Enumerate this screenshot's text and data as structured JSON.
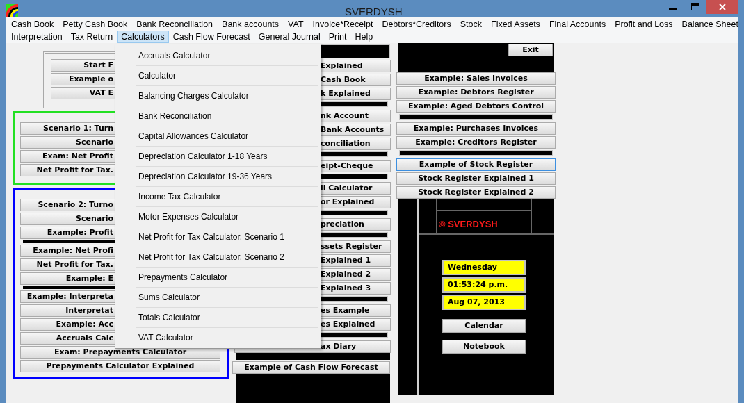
{
  "window": {
    "title": "SVERDYSH"
  },
  "menu_rows": [
    [
      {
        "label": "Cash Book",
        "selected": false
      },
      {
        "label": "Petty Cash Book",
        "selected": false
      },
      {
        "label": "Bank Reconciliation",
        "selected": false
      },
      {
        "label": "Bank accounts",
        "selected": false
      },
      {
        "label": "VAT",
        "selected": false
      },
      {
        "label": "Invoice*Receipt",
        "selected": false
      },
      {
        "label": "Debtors*Creditors",
        "selected": false
      },
      {
        "label": "Stock",
        "selected": false
      },
      {
        "label": "Fixed Assets",
        "selected": false
      },
      {
        "label": "Final Accounts",
        "selected": false
      },
      {
        "label": "Profit and Loss",
        "selected": false
      },
      {
        "label": "Balance Sheet",
        "selected": false
      }
    ],
    [
      {
        "label": "Interpretation",
        "selected": false
      },
      {
        "label": "Tax Return",
        "selected": false
      },
      {
        "label": "Calculators",
        "selected": true
      },
      {
        "label": "Cash Flow Forecast",
        "selected": false
      },
      {
        "label": "General Journal",
        "selected": false
      },
      {
        "label": "Print",
        "selected": false
      },
      {
        "label": "Help",
        "selected": false
      }
    ]
  ],
  "dropdown": {
    "items": [
      "Accruals Calculator",
      "Calculator",
      "Balancing Charges Calculator",
      "Bank Reconciliation",
      "Capital Allowances Calculator",
      "Depreciation Calculator 1-18 Years",
      "Depreciation Calculator 19-36 Years",
      "Income Tax Calculator",
      "Motor Expenses Calculator",
      "Net Profit for Tax Calculator. Scenario 1",
      "Net Profit for Tax Calculator. Scenario 2",
      "Prepayments Calculator",
      "Sums Calculator",
      "Totals Calculator",
      "VAT Calculator"
    ]
  },
  "top_panel": {
    "buttons": [
      "Start F",
      "Example o",
      "VAT E"
    ]
  },
  "scenario_1": {
    "buttons": [
      "Scenario 1: Turn",
      "Scenario",
      "Exam: Net Profit",
      "Net Profit for Tax."
    ]
  },
  "scenario_2": {
    "groups": [
      [
        "Scenario 2: Turno",
        "Scenario",
        "Example: Profit"
      ],
      [
        "Example: Net Profi",
        "Net Profit for Tax.",
        "Example: E"
      ],
      [
        "Example: Interpreta",
        "Interpretat",
        "Example: Acc",
        "Accruals Calc",
        "Exam: Prepayments Calculator",
        "Prepayments Calculator Explained"
      ]
    ]
  },
  "middle": {
    "groups": [
      [
        "Explained",
        "Cash Book",
        "k Explained"
      ],
      [
        "nk Account",
        "Bank Accounts",
        "conciliation"
      ],
      [
        "eipt-Cheque"
      ],
      [
        "ll Calculator",
        "or Explained"
      ],
      [
        "preciation"
      ],
      [
        "ssets Register",
        "Explained 1",
        "Explained 2",
        "Explained 3"
      ],
      [
        "es Example",
        "es Explained"
      ],
      [
        "ax Diary"
      ]
    ],
    "forecast_button": "Example of Cash Flow Forecast"
  },
  "right": {
    "exit": "Exit",
    "groups": [
      [
        {
          "label": "Example: Sales Invoices",
          "selected": false
        },
        {
          "label": "Example: Debtors Register",
          "selected": false
        },
        {
          "label": "Example: Aged Debtors Control",
          "selected": false
        }
      ],
      [
        {
          "label": "Example: Purchases Invoices",
          "selected": false
        },
        {
          "label": "Example: Creditors Register",
          "selected": false
        }
      ],
      [
        {
          "label": "Example of Stock Register",
          "selected": true
        },
        {
          "label": "Stock Register Explained 1",
          "selected": false
        },
        {
          "label": "Stock Register Explained 2",
          "selected": false
        }
      ]
    ],
    "brand": "© SVERDYSH",
    "date_fields": [
      "Wednesday",
      "01:53:24 p.m.",
      "Aug 07, 2013"
    ],
    "buttons": [
      "Calendar",
      "Notebook"
    ]
  }
}
